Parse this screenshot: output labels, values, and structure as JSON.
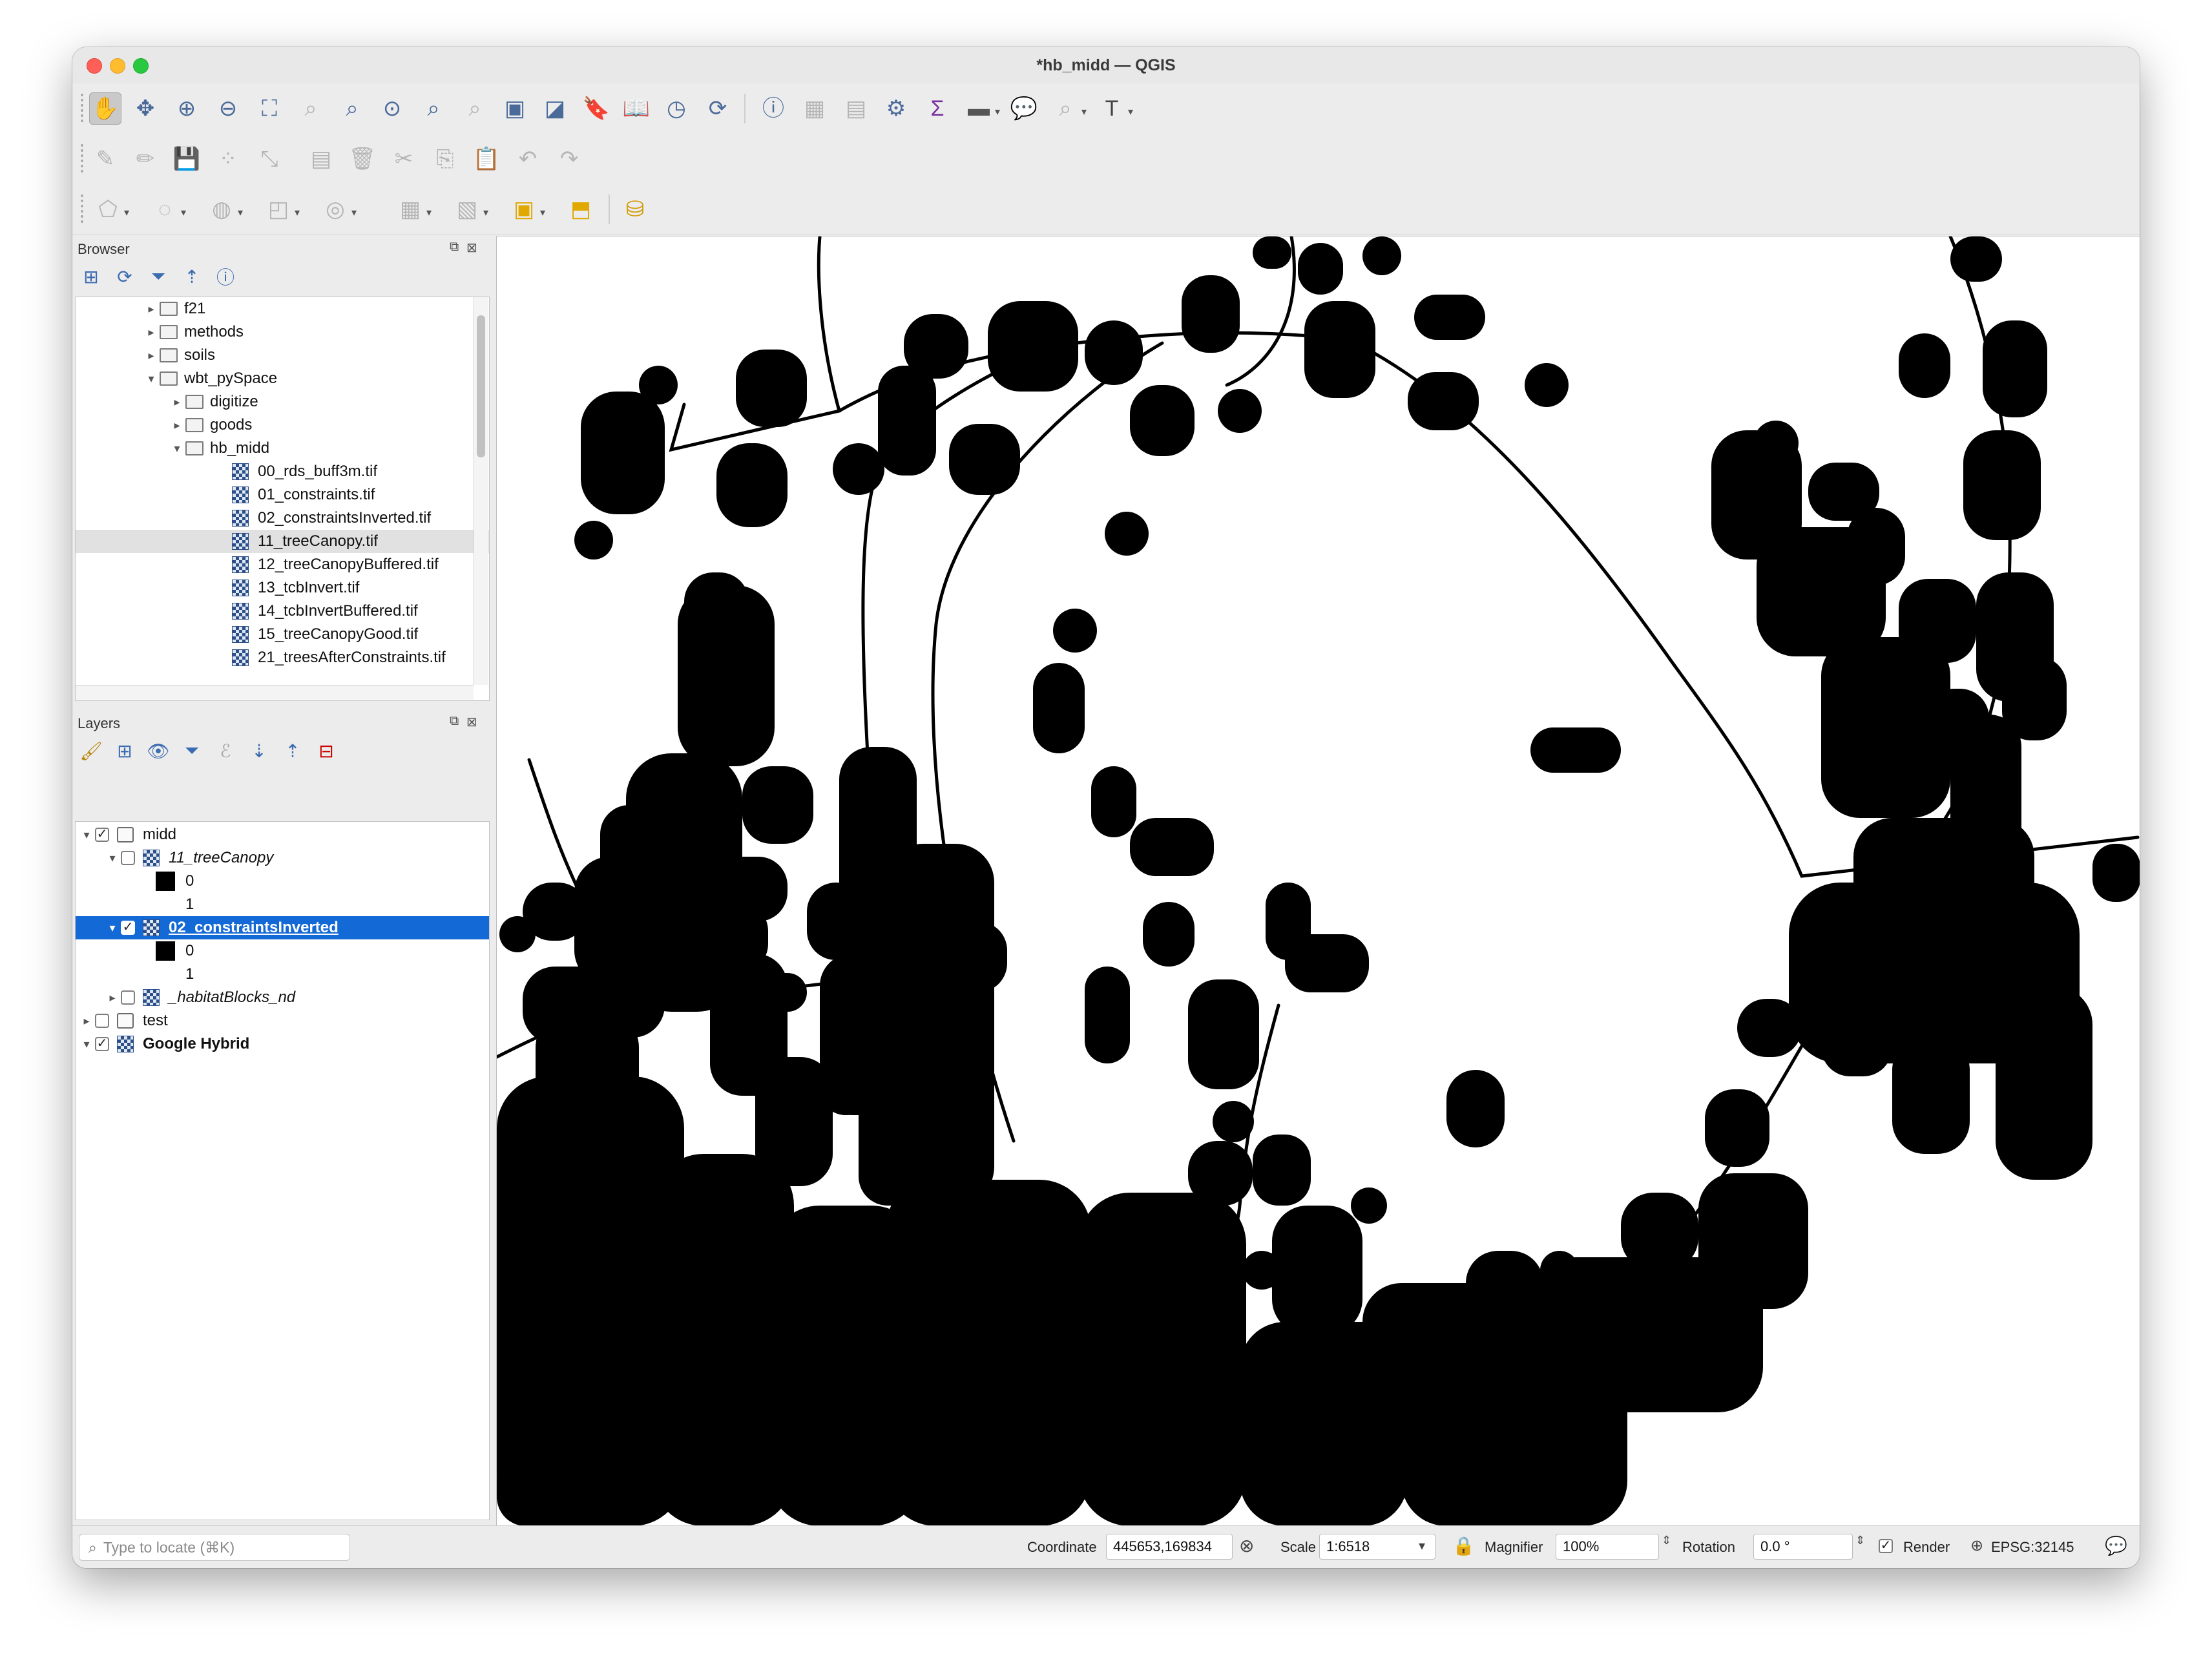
{
  "window": {
    "title": "*hb_midd — QGIS"
  },
  "toolbar": {
    "row1": [
      "pan-hand-icon",
      "pan-to-selection-icon",
      "zoom-in-icon",
      "zoom-out-icon",
      "zoom-full-icon",
      "zoom-to-selection-icon",
      "zoom-to-layer-icon",
      "zoom-native-icon",
      "zoom-last-icon",
      "zoom-next-icon",
      "new-map-view-icon",
      "new-3d-view-icon",
      "new-bookmark-icon",
      "show-bookmarks-icon",
      "temporal-controller-icon",
      "refresh-icon",
      "identify-icon",
      "attribute-table-icon",
      "field-calculator-icon",
      "processing-toolbox-icon",
      "statistics-sigma-icon",
      "measure-icon",
      "map-tips-icon",
      "locator-icon",
      "text-annotation-icon"
    ],
    "row2": [
      "edit-pencil-icon",
      "toggle-editing-icon",
      "save-edits-icon",
      "digitize-icon",
      "vertex-tool-icon",
      "modify-attributes-icon",
      "delete-icon",
      "cut-icon",
      "copy-icon",
      "paste-icon",
      "undo-icon",
      "redo-icon"
    ],
    "row3": [
      "add-polygon-icon",
      "select-features-icon",
      "deselect-icon",
      "select-by-location-icon",
      "select-expression-icon",
      "select-all-icon",
      "select-invert-icon",
      "deselect-layer-icon",
      "show-selection-icon",
      "python-console-icon"
    ]
  },
  "browser": {
    "title": "Browser",
    "items": [
      {
        "label": "f21",
        "type": "folder",
        "expanded": false,
        "indent": 0
      },
      {
        "label": "methods",
        "type": "folder",
        "expanded": false,
        "indent": 0
      },
      {
        "label": "soils",
        "type": "folder",
        "expanded": false,
        "indent": 0
      },
      {
        "label": "wbt_pySpace",
        "type": "folder",
        "expanded": true,
        "indent": 0
      },
      {
        "label": "digitize",
        "type": "folder",
        "expanded": false,
        "indent": 1
      },
      {
        "label": "goods",
        "type": "folder",
        "expanded": false,
        "indent": 1
      },
      {
        "label": "hb_midd",
        "type": "folder",
        "expanded": true,
        "indent": 1
      },
      {
        "label": "00_rds_buff3m.tif",
        "type": "raster",
        "indent": 2
      },
      {
        "label": "01_constraints.tif",
        "type": "raster",
        "indent": 2
      },
      {
        "label": "02_constraintsInverted.tif",
        "type": "raster",
        "indent": 2
      },
      {
        "label": "11_treeCanopy.tif",
        "type": "raster",
        "indent": 2,
        "selected": true
      },
      {
        "label": "12_treeCanopyBuffered.tif",
        "type": "raster",
        "indent": 2
      },
      {
        "label": "13_tcbInvert.tif",
        "type": "raster",
        "indent": 2
      },
      {
        "label": "14_tcbInvertBuffered.tif",
        "type": "raster",
        "indent": 2
      },
      {
        "label": "15_treeCanopyGood.tif",
        "type": "raster",
        "indent": 2
      },
      {
        "label": "21_treesAfterConstraints.tif",
        "type": "raster",
        "indent": 2
      }
    ]
  },
  "layers": {
    "title": "Layers",
    "items": [
      {
        "label": "midd",
        "kind": "group",
        "checked": true,
        "expanded": true
      },
      {
        "label": "11_treeCanopy",
        "kind": "raster",
        "checked": false,
        "expanded": true
      },
      {
        "label": "0",
        "kind": "legend-black"
      },
      {
        "label": "1",
        "kind": "legend-white"
      },
      {
        "label": "02_constraintsInverted",
        "kind": "raster",
        "checked": true,
        "expanded": true,
        "selected": true
      },
      {
        "label": "0",
        "kind": "legend-black"
      },
      {
        "label": "1",
        "kind": "legend-white"
      },
      {
        "label": "_habitatBlocks_nd",
        "kind": "raster",
        "checked": false,
        "expanded": false
      },
      {
        "label": "test",
        "kind": "group",
        "checked": false,
        "expanded": false
      },
      {
        "label": "Google Hybrid",
        "kind": "xyz",
        "checked": true,
        "expanded": true
      }
    ]
  },
  "statusbar": {
    "locate_placeholder": "Type to locate (⌘K)",
    "coordinate_label": "Coordinate",
    "coordinate_value": "445653,169834",
    "scale_label": "Scale",
    "scale_value": "1:6518",
    "magnifier_label": "Magnifier",
    "magnifier_value": "100%",
    "rotation_label": "Rotation",
    "rotation_value": "0.0 °",
    "render_label": "Render",
    "render_checked": true,
    "crs_value": "EPSG:32145"
  },
  "map": {
    "background_color": "#ffffff",
    "feature_color": "#000000"
  }
}
